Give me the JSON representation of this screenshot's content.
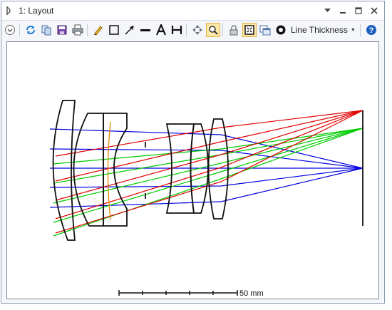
{
  "window": {
    "title": "1: Layout",
    "controls": [
      "pin-dropdown-icon",
      "minimize-icon",
      "restore-icon",
      "close-icon"
    ]
  },
  "toolbar": {
    "buttons": [
      {
        "name": "expand-icon"
      },
      {
        "name": "refresh-icon"
      },
      {
        "name": "copy-icon"
      },
      {
        "name": "save-icon"
      },
      {
        "name": "print-icon"
      },
      {
        "name": "pencil-icon"
      },
      {
        "name": "rectangle-icon"
      },
      {
        "name": "arrow-icon"
      },
      {
        "name": "line-icon"
      },
      {
        "name": "text-icon"
      },
      {
        "name": "dimension-icon"
      },
      {
        "name": "pan-icon"
      },
      {
        "name": "zoom-icon",
        "active": true
      },
      {
        "name": "lock-icon"
      },
      {
        "name": "fit-icon",
        "active": true
      },
      {
        "name": "windows-icon"
      },
      {
        "name": "settings-icon"
      }
    ],
    "line_thickness_label": "Line Thickness",
    "help_icon": "help-icon"
  },
  "layout": {
    "scale_label": "50 mm",
    "field_colors": {
      "on_axis": "#0000e0",
      "mid_field": "#00cc00",
      "full_field": "#e00000"
    }
  }
}
